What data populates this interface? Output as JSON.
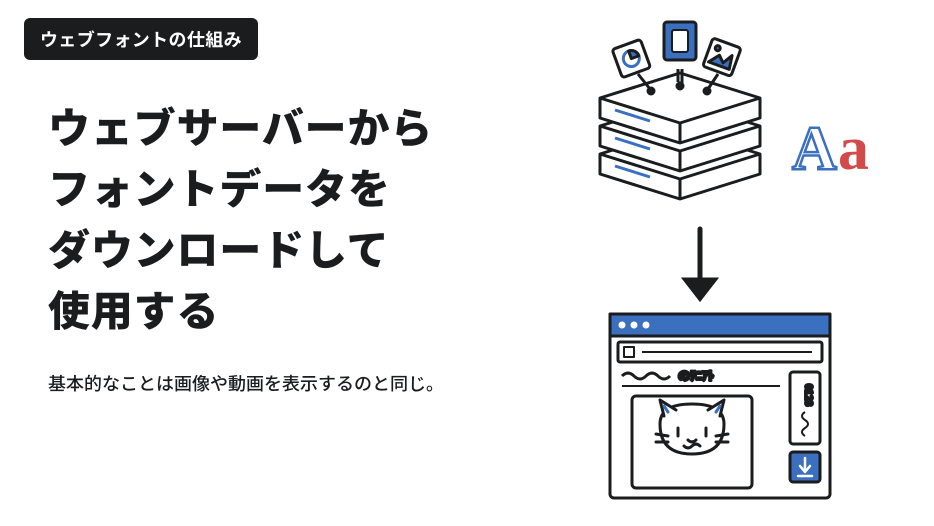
{
  "badge": "ウェブフォントの仕組み",
  "title_lines": [
    "ウェブサーバーから",
    "フォントデータを",
    "ダウンロードして",
    "使用する"
  ],
  "subtitle": "基本的なことは画像や動画を表示するのと同じ。",
  "aa_letters": "Aa",
  "illustration": {
    "server_label": "server",
    "browser_label": "browser",
    "arrow_label": "download"
  }
}
